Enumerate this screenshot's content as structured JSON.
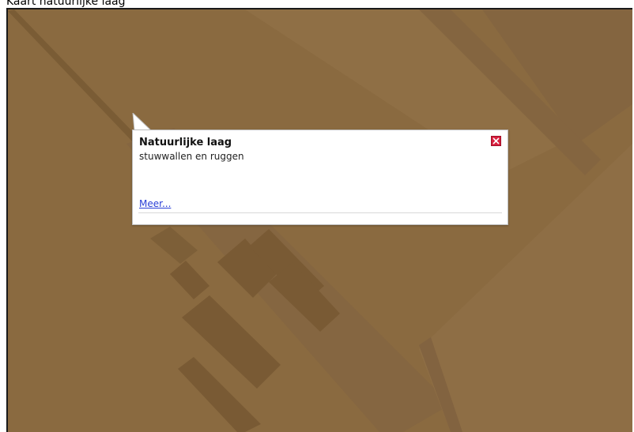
{
  "page": {
    "heading": "Kaart natuurlijke laag"
  },
  "map": {
    "background_color": "#8a6a40",
    "feature_color": "#7b5d36"
  },
  "popup": {
    "title": "Natuurlijke laag",
    "value": "stuwwallen en ruggen",
    "link_label": "Meer...",
    "close_icon": "close-icon",
    "close_color": "#d8203f"
  }
}
